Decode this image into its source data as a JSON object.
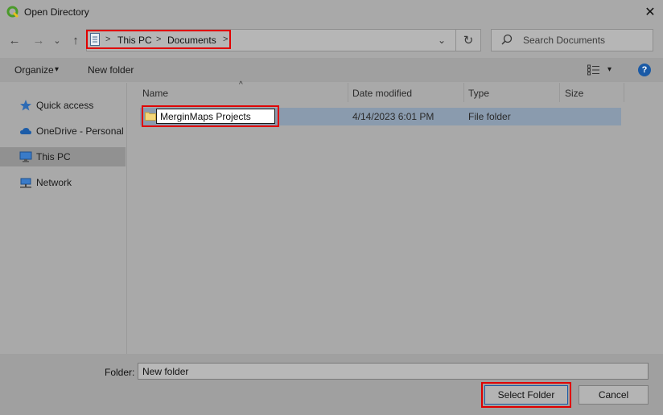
{
  "window": {
    "title": "Open Directory",
    "close_glyph": "✕"
  },
  "nav": {
    "back_glyph": "←",
    "forward_glyph": "→",
    "recent_glyph": "⌄",
    "up_glyph": "↑",
    "breadcrumb": [
      "This PC",
      "Documents"
    ],
    "separator": ">",
    "dropdown_glyph": "⌄",
    "refresh_glyph": "↻"
  },
  "search": {
    "placeholder": "Search Documents"
  },
  "toolbar": {
    "organize_label": "Organize",
    "organize_caret": "▾",
    "new_folder_label": "New folder",
    "view_caret": "▾",
    "help_glyph": "?"
  },
  "sidebar": {
    "items": [
      {
        "label": "Quick access",
        "icon": "star-icon"
      },
      {
        "label": "OneDrive - Personal",
        "icon": "cloud-icon"
      },
      {
        "label": "This PC",
        "icon": "computer-icon",
        "selected": true
      },
      {
        "label": "Network",
        "icon": "network-icon"
      }
    ]
  },
  "list": {
    "sort_glyph": "^",
    "columns": [
      "Name",
      "Date modified",
      "Type",
      "Size"
    ],
    "rows": [
      {
        "name": "MerginMaps Projects",
        "date": "4/14/2023 6:01 PM",
        "type": "File folder",
        "size": ""
      }
    ]
  },
  "footer": {
    "folder_label": "Folder:",
    "folder_value": "New folder",
    "select_button": "Select Folder",
    "cancel_button": "Cancel"
  },
  "colors": {
    "highlight": "#e00000",
    "selected_row": "#8a9bae",
    "help_blue": "#1a5aa6"
  }
}
